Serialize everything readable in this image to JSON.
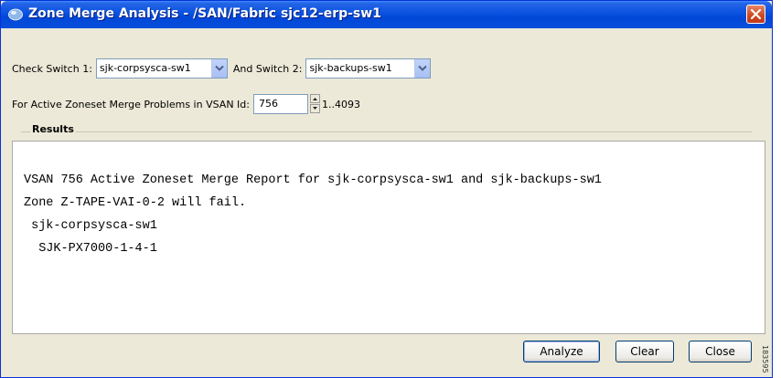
{
  "window": {
    "title": "Zone Merge Analysis - /SAN/Fabric sjc12-erp-sw1"
  },
  "switches": {
    "check_label": "Check Switch 1:",
    "switch1_value": "sjk-corpsysca-sw1",
    "and_label": "And Switch 2:",
    "switch2_value": "sjk-backups-sw1"
  },
  "vsan": {
    "label": "For Active Zoneset Merge Problems in VSAN Id:",
    "value": "756",
    "range": "1..4093"
  },
  "results": {
    "group_title": "Results",
    "text": "VSAN 756 Active Zoneset Merge Report for sjk-corpsysca-sw1 and sjk-backups-sw1\nZone Z-TAPE-VAI-0-2 will fail.\n sjk-corpsysca-sw1\n  SJK-PX7000-1-4-1"
  },
  "buttons": {
    "analyze": "Analyze",
    "clear": "Clear",
    "close": "Close"
  },
  "side_id": "183595",
  "colors": {
    "titlebar": "#0a52e0",
    "dialog_bg": "#ece9d8",
    "close_button": "#d04a20"
  }
}
